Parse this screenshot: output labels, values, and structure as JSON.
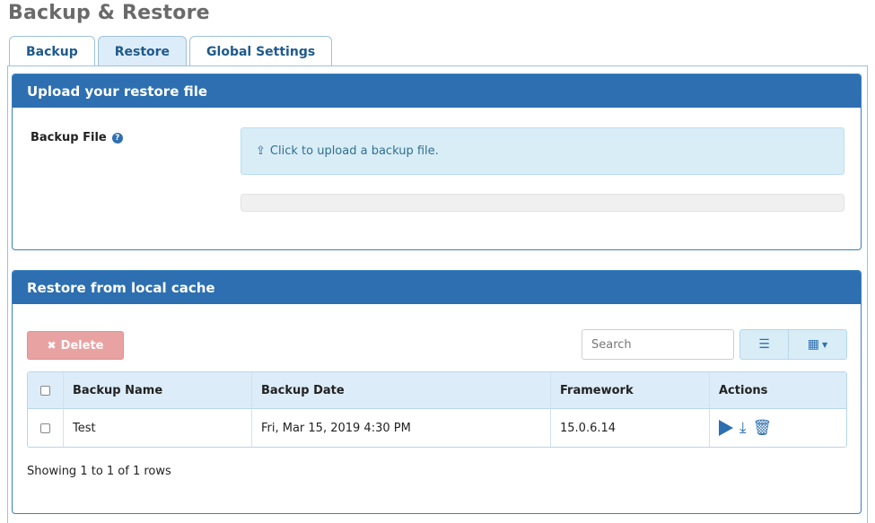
{
  "page": {
    "title": "Backup & Restore"
  },
  "tabs": [
    {
      "label": "Backup",
      "active": false
    },
    {
      "label": "Restore",
      "active": true
    },
    {
      "label": "Global Settings",
      "active": false
    }
  ],
  "upload_panel": {
    "title": "Upload your restore file",
    "field_label": "Backup File",
    "dropzone_text": "Click to upload a backup file.",
    "progress": 0
  },
  "cache_panel": {
    "title": "Restore from local cache",
    "delete_label": "Delete",
    "search_placeholder": "Search",
    "columns": [
      "Backup Name",
      "Backup Date",
      "Framework",
      "Actions"
    ],
    "rows": [
      {
        "name": "Test",
        "date": "Fri, Mar 15, 2019 4:30 PM",
        "framework": "15.0.6.14"
      }
    ],
    "showing_text": "Showing 1 to 1 of 1 rows"
  },
  "icons": {
    "help": "question-circle-icon",
    "upload": "upload-icon",
    "delete": "user-times-icon",
    "list": "list-icon",
    "columns": "grid-icon",
    "play": "play-icon",
    "download": "download-icon",
    "trash": "trash-icon"
  },
  "colors": {
    "header_bg": "#2d6fb0",
    "dropzone_bg": "#d9edf7",
    "delete_bg": "#e9a2a2",
    "table_head_bg": "#dcecf8"
  }
}
